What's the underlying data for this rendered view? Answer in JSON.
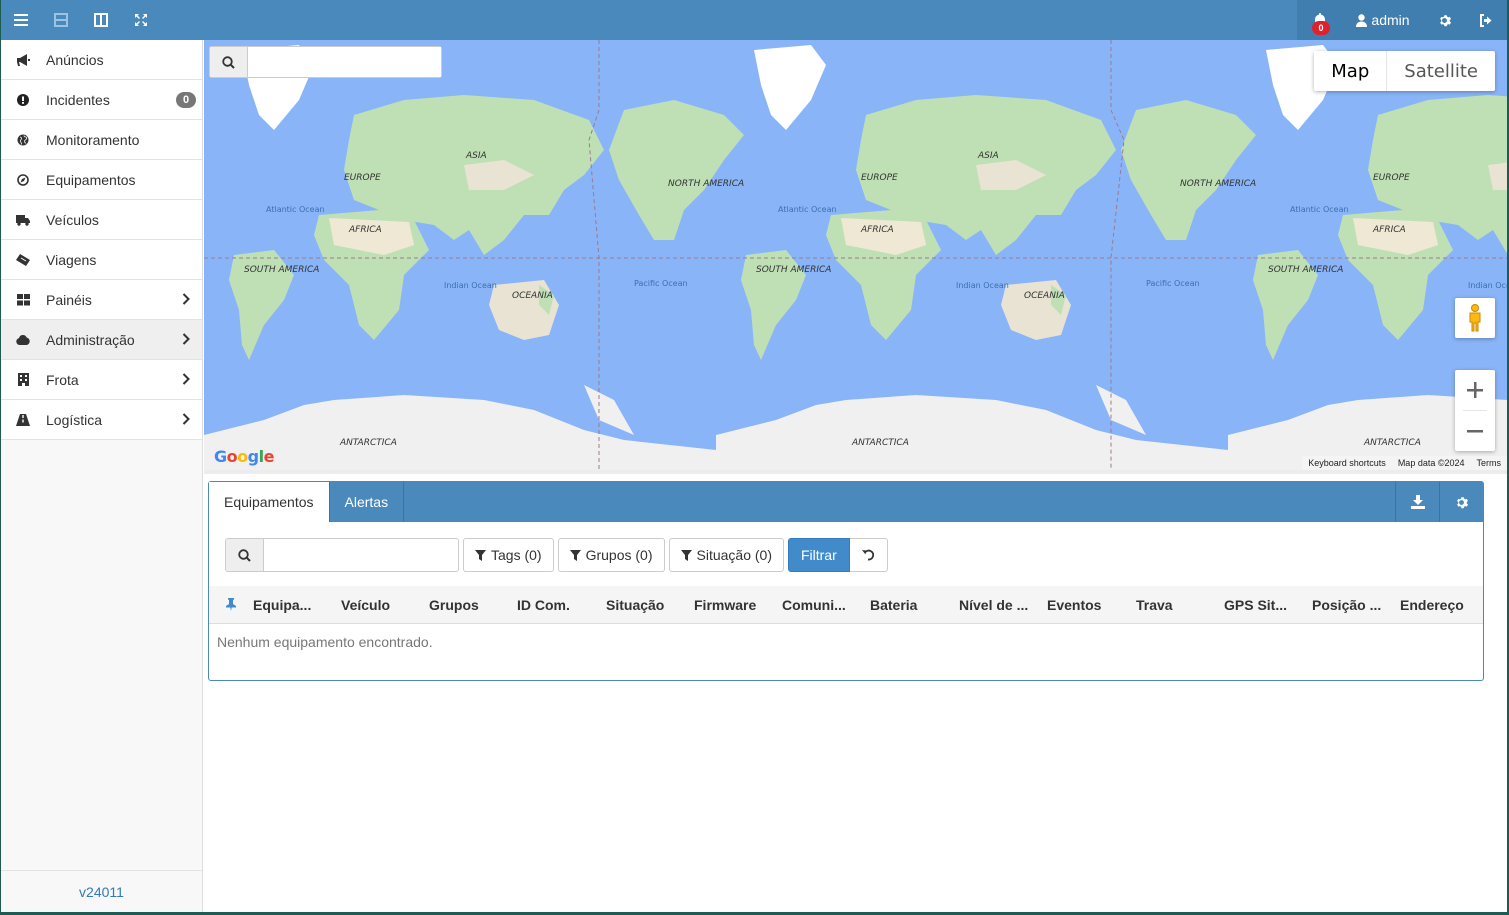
{
  "topbar": {
    "notifications_count": "0",
    "user_name": "admin"
  },
  "sidebar": {
    "items": [
      {
        "label": "Anúncios",
        "icon": "megaphone-icon"
      },
      {
        "label": "Incidentes",
        "icon": "exclamation-circle-icon",
        "badge": "0"
      },
      {
        "label": "Monitoramento",
        "icon": "globe-icon"
      },
      {
        "label": "Equipamentos",
        "icon": "compass-icon"
      },
      {
        "label": "Veículos",
        "icon": "truck-icon"
      },
      {
        "label": "Viagens",
        "icon": "ticket-icon"
      },
      {
        "label": "Painéis",
        "icon": "dashboard-grid-icon"
      },
      {
        "label": "Administração",
        "icon": "cloud-icon"
      },
      {
        "label": "Frota",
        "icon": "building-icon"
      },
      {
        "label": "Logística",
        "icon": "road-icon"
      }
    ],
    "version": "v24011"
  },
  "map": {
    "type_map": "Map",
    "type_satellite": "Satellite",
    "google_logo": "Google",
    "footer_shortcuts": "Keyboard shortcuts",
    "footer_data": "Map data ©2024",
    "footer_terms": "Terms",
    "labels": {
      "north_america": "NORTH AMERICA",
      "south_america": "SOUTH AMERICA",
      "europe": "EUROPE",
      "asia": "ASIA",
      "africa": "AFRICA",
      "oceania": "OCEANIA",
      "antarctica": "ANTARCTICA",
      "atlantic": "Atlantic Ocean",
      "indian": "Indian Ocean",
      "pacific": "Pacific Ocean"
    }
  },
  "panel": {
    "tabs": [
      "Equipamentos",
      "Alertas"
    ],
    "filters": {
      "tags": "Tags (0)",
      "grupos": "Grupos (0)",
      "situacao": "Situação (0)",
      "filtrar": "Filtrar"
    },
    "columns": [
      "Equipa...",
      "Veículo",
      "Grupos",
      "ID Com.",
      "Situação",
      "Firmware",
      "Comuni...",
      "Bateria",
      "Nível de ...",
      "Eventos",
      "Trava",
      "GPS Sit...",
      "Posição ...",
      "Endereço"
    ],
    "empty_message": "Nenhum equipamento encontrado."
  },
  "colors": {
    "primary": "#4a89bb",
    "button_primary": "#428bca",
    "badge_red": "#e0202a",
    "ocean": "#8ab4f8",
    "land": "#bfe0b5"
  }
}
